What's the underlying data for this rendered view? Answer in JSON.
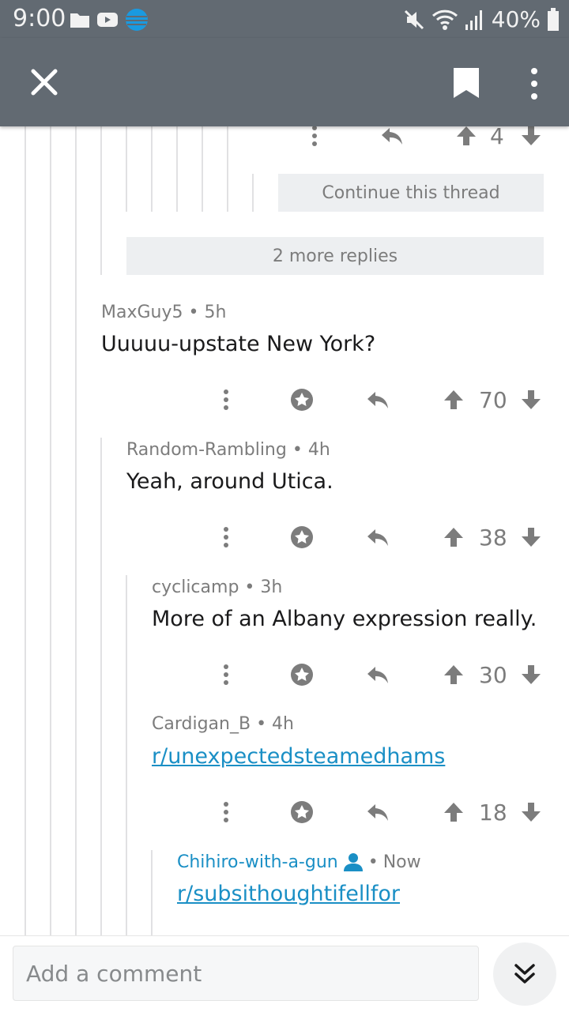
{
  "status_bar": {
    "time": "9:00",
    "battery": "40%"
  },
  "comments": [
    {
      "author": "MaxGuy5",
      "age": "5h",
      "text": "Uuuuu-upstate New York?",
      "score": "70"
    },
    {
      "author": "Random-Rambling",
      "age": "4h",
      "text": "Yeah, around Utica.",
      "score": "38"
    },
    {
      "author": "cyclicamp",
      "age": "3h",
      "text": "More of an Albany expression really.",
      "score": "30"
    },
    {
      "author": "Cardigan_B",
      "age": "4h",
      "text": "r/unexpectedsteamedhams",
      "score": "18"
    },
    {
      "author": "Chihiro-with-a-gun",
      "age": "Now",
      "text": "r/subsithoughtifellfor"
    }
  ],
  "top_partial": {
    "score": "4"
  },
  "buttons": {
    "continue_thread": "Continue this thread",
    "more_replies": "2 more replies"
  },
  "separator": "•",
  "composer": {
    "placeholder": "Add a comment"
  },
  "colors": {
    "header": "#626a72",
    "link": "#1a8fc5",
    "op_author": "#1a8fc5"
  }
}
